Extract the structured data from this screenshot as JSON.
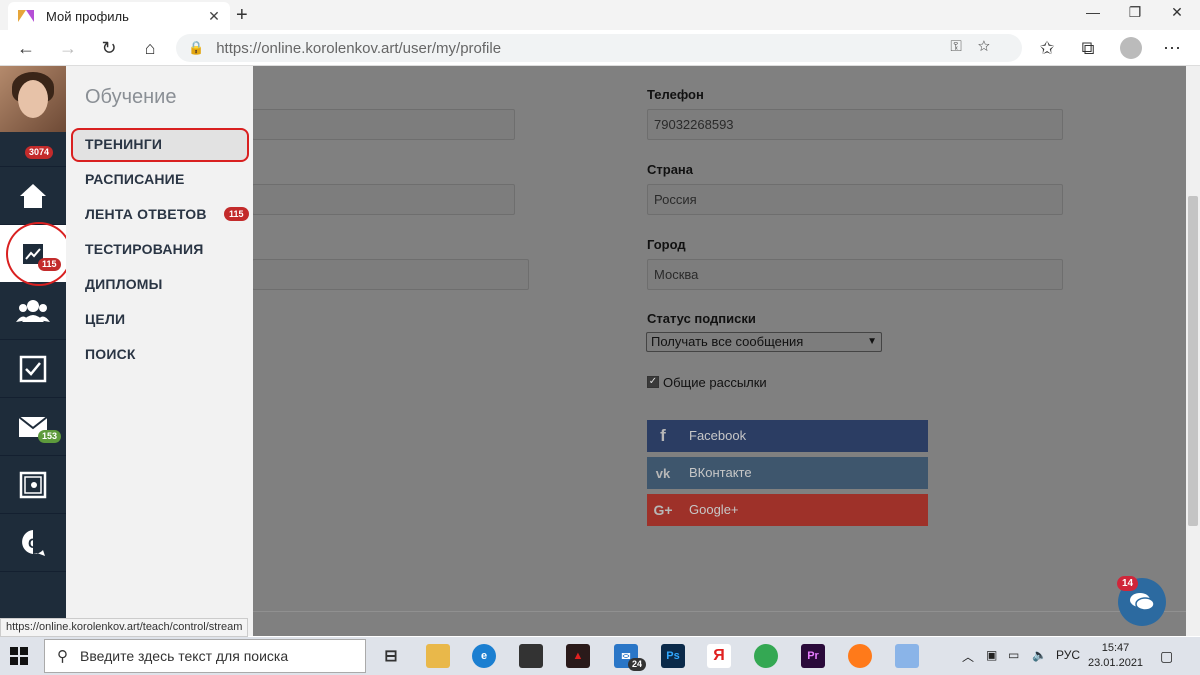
{
  "browser": {
    "tab_title": "Мой профиль",
    "url_prefix": "https://online.korolenkov.art",
    "url_path": "/user/my/profile"
  },
  "sidebar": {
    "badge_top": "3074",
    "badge_stats": "115",
    "badge_mail": "153"
  },
  "menu": {
    "heading": "Обучение",
    "items": [
      "ТРЕНИНГИ",
      "РАСПИСАНИЕ",
      "ЛЕНТА ОТВЕТОВ",
      "ТЕСТИРОВАНИЯ",
      "ДИПЛОМЫ",
      "ЦЕЛИ",
      "ПОИСК"
    ],
    "answers_badge": "115"
  },
  "form": {
    "phone_label": "Телефон",
    "phone_value": "79032268593",
    "country_label": "Страна",
    "country_value": "Россия",
    "city_label": "Город",
    "city_value": "Москва",
    "subscription_label": "Статус подписки",
    "subscription_value": "Получать все сообщения",
    "newsletter_label": "Общие рассылки",
    "newsletter_checked": true
  },
  "social": {
    "facebook": "Facebook",
    "vk": "ВКонтакте",
    "google": "Google+"
  },
  "chat": {
    "badge": "14"
  },
  "status_url": "https://online.korolenkov.art/teach/control/stream",
  "taskbar": {
    "search_placeholder": "Введите здесь текст для поиска",
    "mail_badge": "24",
    "lang": "РУС",
    "time": "15:47",
    "date": "23.01.2021"
  },
  "colors": {
    "sidebar_bg": "#1e2c3a",
    "facebook": "#2b3d63",
    "vk": "#3e566d",
    "google": "#9e3129",
    "highlight": "#d92020"
  }
}
